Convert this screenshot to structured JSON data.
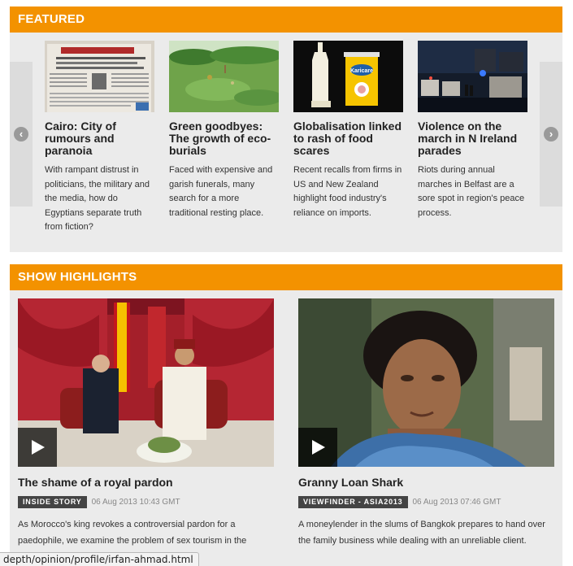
{
  "featured": {
    "heading": "FEATURED",
    "items": [
      {
        "title": "Cairo: City of rumours and paranoia",
        "desc": "With rampant distrust in politicians, the military and the media, how do Egyptians separate truth from fiction?"
      },
      {
        "title": "Green goodbyes: The growth of eco-burials",
        "desc": "Faced with expensive and garish funerals, many search for a more traditional resting place."
      },
      {
        "title": "Globalisation linked to rash of food scares",
        "desc": "Recent recalls from firms in US and New Zealand highlight food industry's reliance on imports.",
        "can_label": "Karicare"
      },
      {
        "title": "Violence on the march in N Ireland parades",
        "desc": "Riots during annual marches in Belfast are a sore spot in region's peace process."
      }
    ],
    "prev_icon": "chevron-left-icon",
    "next_icon": "chevron-right-icon"
  },
  "highlights": {
    "heading": "SHOW HIGHLIGHTS",
    "items": [
      {
        "title": "The shame of a royal pardon",
        "tag": "INSIDE STORY",
        "date": "06 Aug 2013 10:43 GMT",
        "desc": "As Morocco's king revokes a controversial pardon for a paedophile, we examine the problem of sex tourism in the kingdom."
      },
      {
        "title": "Granny Loan Shark",
        "tag": "VIEWFINDER - ASIA2013",
        "date": "06 Aug 2013 07:46 GMT",
        "desc": "A moneylender in the slums of Bangkok prepares to hand over the family business while dealing with an unreliable client."
      }
    ]
  },
  "status_bar": {
    "url": "depth/opinion/profile/irfan-ahmad.html"
  },
  "colors": {
    "accent": "#f39200",
    "panel": "#ebebeb",
    "tag_bg": "#444444"
  }
}
